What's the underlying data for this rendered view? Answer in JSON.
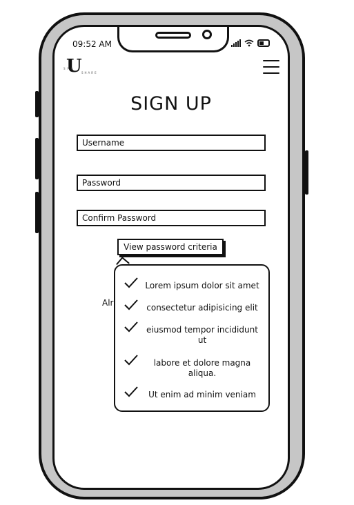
{
  "status": {
    "time": "09:52 AM"
  },
  "header": {
    "logo_letter": "U",
    "logo_sub_top": "SPA",
    "logo_sub_bottom": "SHARE"
  },
  "form": {
    "title": "SIGN UP",
    "username_placeholder": "Username",
    "password_placeholder": "Password",
    "confirm_placeholder": "Confirm Password",
    "criteria_button": "View password criteria",
    "partial_text": "Alr"
  },
  "criteria": [
    {
      "text": "Lorem ipsum dolor sit amet"
    },
    {
      "text": "consectetur adipisicing elit"
    },
    {
      "text": "eiusmod tempor incididunt ut"
    },
    {
      "text": "labore et dolore magna aliqua."
    },
    {
      "text": "Ut enim ad minim veniam"
    }
  ],
  "icons": {
    "check": "check-icon",
    "menu": "hamburger-menu-icon",
    "wifi": "wifi-icon",
    "battery": "battery-icon",
    "signal": "signal-icon"
  }
}
